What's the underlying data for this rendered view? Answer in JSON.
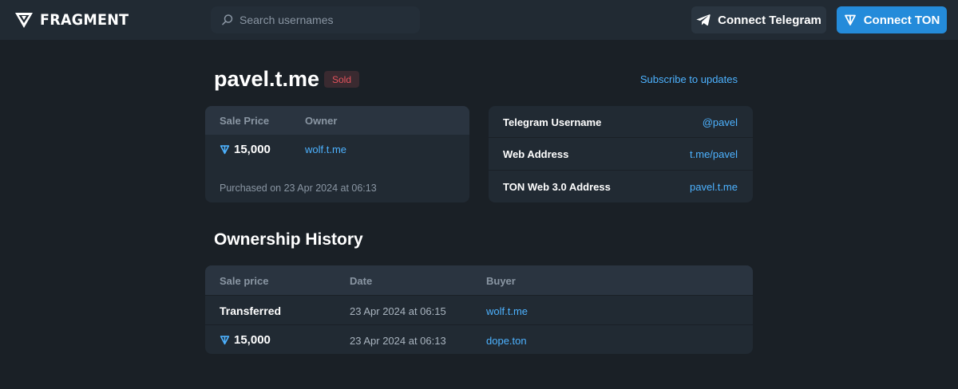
{
  "header": {
    "brand": "FRAGMENT",
    "search_placeholder": "Search usernames",
    "connect_telegram": "Connect Telegram",
    "connect_ton": "Connect TON"
  },
  "item": {
    "name": "pavel.t.me",
    "status": "Sold",
    "subscribe": "Subscribe to updates"
  },
  "sale": {
    "price_label": "Sale Price",
    "owner_label": "Owner",
    "price": "15,000",
    "owner": "wolf.t.me",
    "purchased": "Purchased on 23 Apr 2024 at 06:13"
  },
  "info": [
    {
      "label": "Telegram Username",
      "value": "@pavel"
    },
    {
      "label": "Web Address",
      "value": "t.me/pavel"
    },
    {
      "label": "TON Web 3.0 Address",
      "value": "pavel.t.me"
    }
  ],
  "history": {
    "title": "Ownership History",
    "columns": [
      "Sale price",
      "Date",
      "Buyer"
    ],
    "rows": [
      {
        "price": "Transferred",
        "date": "23 Apr 2024 at 06:15",
        "buyer": "wolf.t.me"
      },
      {
        "price": "15,000",
        "date": "23 Apr 2024 at 06:13",
        "buyer": "dope.ton"
      }
    ]
  },
  "colors": {
    "background": "#1a2026",
    "card": "#212a33",
    "accent": "#248bda",
    "link": "#4db2ff",
    "sold": "#e2525c"
  }
}
